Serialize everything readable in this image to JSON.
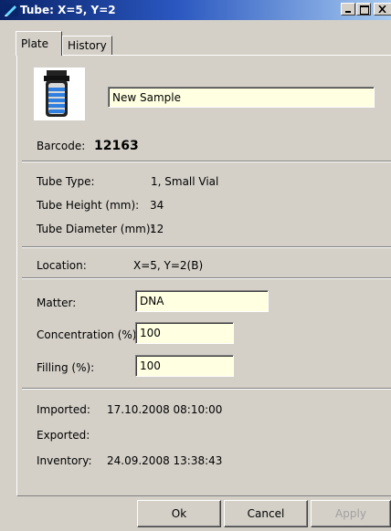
{
  "window": {
    "title": "Tube: X=5, Y=2"
  },
  "tabs": [
    {
      "label": "Plate",
      "active": true
    },
    {
      "label": "History",
      "active": false
    }
  ],
  "sample": {
    "name": "New Sample"
  },
  "barcode": {
    "label": "Barcode:",
    "value": "12163"
  },
  "tube": {
    "type_label": "Tube Type:",
    "type_value": "1, Small Vial",
    "height_label": "Tube Height (mm):",
    "height_value": "34",
    "diameter_label": "Tube Diameter (mm):",
    "diameter_value": "12"
  },
  "location": {
    "label": "Location:",
    "value": "X=5, Y=2(B)"
  },
  "fields": {
    "matter_label": "Matter:",
    "matter_value": "DNA",
    "concentration_label": "Concentration (%):",
    "concentration_value": "100",
    "filling_label": "Filling (%):",
    "filling_value": "100"
  },
  "dates": {
    "imported_label": "Imported:",
    "imported_value": "17.10.2008 08:10:00",
    "exported_label": "Exported:",
    "exported_value": "",
    "inventory_label": "Inventory:",
    "inventory_value": "24.09.2008 13:38:43"
  },
  "buttons": {
    "ok": "Ok",
    "cancel": "Cancel",
    "apply": "Apply"
  },
  "colors": {
    "title_start": "#0a246a",
    "title_end": "#a6caf0",
    "field_bg": "#ffffe1",
    "dialog_bg": "#d4d0c8"
  },
  "icons": {
    "title": "pencil-icon",
    "tube": "tube-icon"
  }
}
